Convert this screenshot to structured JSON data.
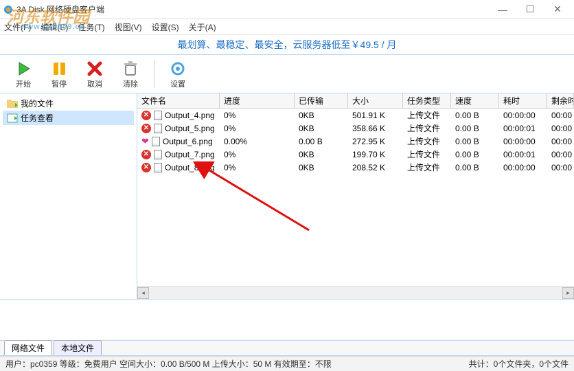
{
  "window": {
    "title": "3A Disk 网络硬盘客户端",
    "min": "—",
    "max": "☐",
    "close": "✕"
  },
  "watermark": {
    "text1": "河东软件园",
    "text2": "www.pc0359.cn"
  },
  "menu": {
    "file": "文件(F)",
    "edit": "编辑(E)",
    "task": "任务(T)",
    "view": "视图(V)",
    "settings": "设置(S)",
    "about": "关于(A)"
  },
  "promo": "最划算、最稳定、最安全，云服务器低至￥49.5 / 月",
  "toolbar": {
    "start": "开始",
    "pause": "暂停",
    "cancel": "取消",
    "clear": "清除",
    "settings": "设置"
  },
  "sidebar": {
    "items": [
      {
        "label": "我的文件"
      },
      {
        "label": "任务查看"
      }
    ]
  },
  "columns": {
    "name": "文件名",
    "progress": "进度",
    "transferred": "已传输",
    "size": "大小",
    "type": "任务类型",
    "speed": "速度",
    "time": "耗时",
    "remain": "剩余时"
  },
  "rows": [
    {
      "status": "x",
      "name": "Output_4.png",
      "progress": "0%",
      "transferred": "0KB",
      "size": "501.91 K",
      "type": "上传文件",
      "speed": "0.00 B",
      "time": "00:00:00",
      "remain": "00:00"
    },
    {
      "status": "x",
      "name": "Output_5.png",
      "progress": "0%",
      "transferred": "0KB",
      "size": "358.66 K",
      "type": "上传文件",
      "speed": "0.00 B",
      "time": "00:00:01",
      "remain": "00:00"
    },
    {
      "status": "h",
      "name": "Output_6.png",
      "progress": "0.00%",
      "transferred": "0.00 B",
      "size": "272.95 K",
      "type": "上传文件",
      "speed": "0.00 B",
      "time": "00:00:00",
      "remain": "00:00"
    },
    {
      "status": "x",
      "name": "Output_7.png",
      "progress": "0%",
      "transferred": "0KB",
      "size": "199.70 K",
      "type": "上传文件",
      "speed": "0.00 B",
      "time": "00:00:01",
      "remain": "00:00"
    },
    {
      "status": "x",
      "name": "Output_8.png",
      "progress": "0%",
      "transferred": "0KB",
      "size": "208.52 K",
      "type": "上传文件",
      "speed": "0.00 B",
      "time": "00:00:00",
      "remain": "00:00"
    }
  ],
  "tabs": {
    "net": "网络文件",
    "local": "本地文件"
  },
  "status": {
    "left": "用户：pc0359  等级：免费用户  空间大小：0.00 B/500 M  上传大小：50 M  有效期至：不限",
    "right": "共计：0个文件夹，0个文件"
  }
}
